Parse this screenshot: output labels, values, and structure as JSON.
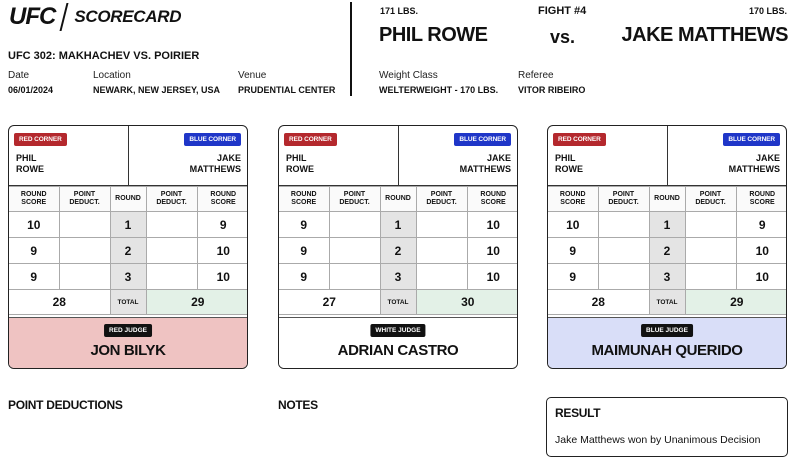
{
  "header": {
    "logo": "UFC",
    "title": "SCORECARD",
    "event": "UFC 302: MAKHACHEV VS. POIRIER",
    "date_label": "Date",
    "date": "06/01/2024",
    "location_label": "Location",
    "location": "NEWARK, NEW JERSEY, USA",
    "venue_label": "Venue",
    "venue": "PRUDENTIAL CENTER"
  },
  "fight": {
    "number": "FIGHT #4",
    "red_weight": "171 LBS.",
    "blue_weight": "170 LBS.",
    "red_name": "PHIL ROWE",
    "vs": "vs.",
    "blue_name": "JAKE MATTHEWS",
    "weight_class_label": "Weight Class",
    "weight_class": "WELTERWEIGHT - 170 LBS.",
    "referee_label": "Referee",
    "referee": "VITOR RIBEIRO"
  },
  "table_headers": {
    "round_score": "ROUND SCORE",
    "point_deduct": "POINT DEDUCT.",
    "round": "ROUND",
    "total": "TOTAL"
  },
  "cards": [
    {
      "red_badge": "RED CORNER",
      "blue_badge": "BLUE CORNER",
      "red_first": "PHIL",
      "red_last": "ROWE",
      "blue_first": "JAKE",
      "blue_last": "MATTHEWS",
      "rounds": [
        {
          "red": "10",
          "round": "1",
          "blue": "9"
        },
        {
          "red": "9",
          "round": "2",
          "blue": "10"
        },
        {
          "red": "9",
          "round": "3",
          "blue": "10"
        }
      ],
      "red_total": "28",
      "blue_total": "29",
      "judge_badge": "RED JUDGE",
      "judge_name": "JON BILYK"
    },
    {
      "red_badge": "RED CORNER",
      "blue_badge": "BLUE CORNER",
      "red_first": "PHIL",
      "red_last": "ROWE",
      "blue_first": "JAKE",
      "blue_last": "MATTHEWS",
      "rounds": [
        {
          "red": "9",
          "round": "1",
          "blue": "10"
        },
        {
          "red": "9",
          "round": "2",
          "blue": "10"
        },
        {
          "red": "9",
          "round": "3",
          "blue": "10"
        }
      ],
      "red_total": "27",
      "blue_total": "30",
      "judge_badge": "WHITE JUDGE",
      "judge_name": "ADRIAN CASTRO"
    },
    {
      "red_badge": "RED CORNER",
      "blue_badge": "BLUE CORNER",
      "red_first": "PHIL",
      "red_last": "ROWE",
      "blue_first": "JAKE",
      "blue_last": "MATTHEWS",
      "rounds": [
        {
          "red": "10",
          "round": "1",
          "blue": "9"
        },
        {
          "red": "9",
          "round": "2",
          "blue": "10"
        },
        {
          "red": "9",
          "round": "3",
          "blue": "10"
        }
      ],
      "red_total": "28",
      "blue_total": "29",
      "judge_badge": "BLUE JUDGE",
      "judge_name": "MAIMUNAH QUERIDO"
    }
  ],
  "sections": {
    "point_deductions": "POINT DEDUCTIONS",
    "notes": "NOTES",
    "result_title": "RESULT",
    "result_text": "Jake Matthews won by Unanimous Decision"
  },
  "colors": {
    "red_corner": "#b4282d",
    "blue_corner": "#1f36c8",
    "red_judge_bg": "#efc3c2",
    "blue_judge_bg": "#d9def8",
    "total_win_bg": "#e3f1e7"
  }
}
